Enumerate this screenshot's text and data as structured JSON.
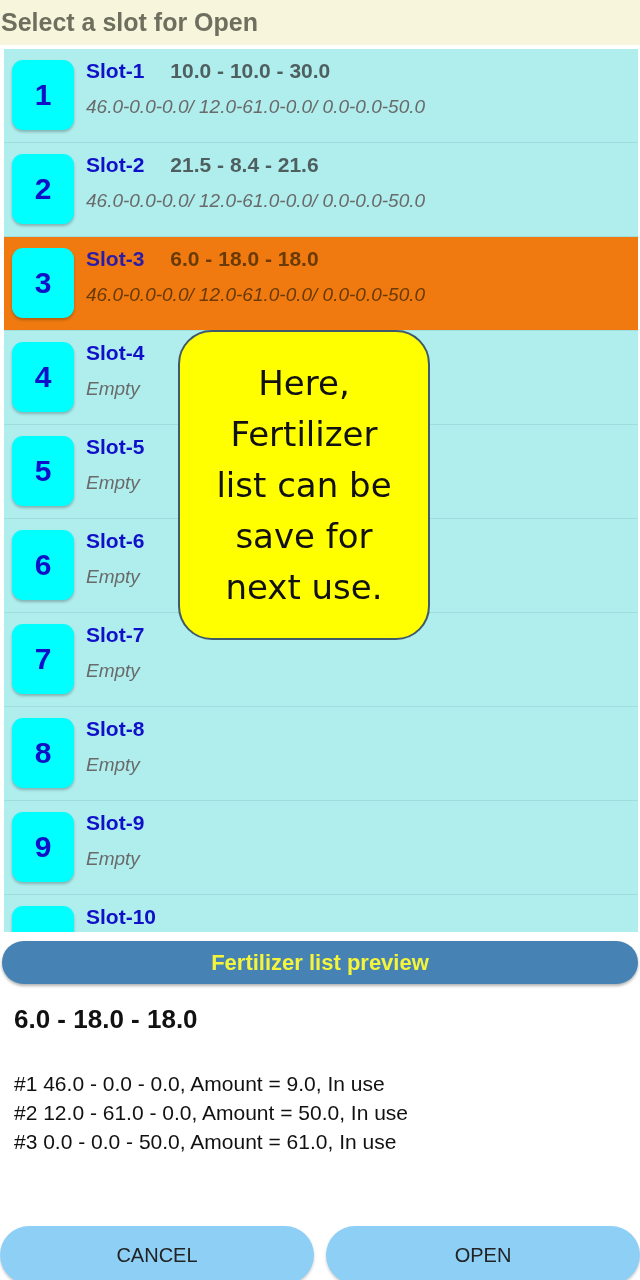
{
  "title": "Select a slot for Open",
  "slots": [
    {
      "number": "1",
      "name": "Slot-1",
      "npk": "10.0 - 10.0 - 30.0",
      "detail": "46.0-0.0-0.0/ 12.0-61.0-0.0/ 0.0-0.0-50.0",
      "selected": false
    },
    {
      "number": "2",
      "name": "Slot-2",
      "npk": "21.5 - 8.4 - 21.6",
      "detail": "46.0-0.0-0.0/ 12.0-61.0-0.0/ 0.0-0.0-50.0",
      "selected": false
    },
    {
      "number": "3",
      "name": "Slot-3",
      "npk": "6.0 - 18.0 - 18.0",
      "detail": "46.0-0.0-0.0/ 12.0-61.0-0.0/ 0.0-0.0-50.0",
      "selected": true
    },
    {
      "number": "4",
      "name": "Slot-4",
      "detail": "Empty",
      "selected": false
    },
    {
      "number": "5",
      "name": "Slot-5",
      "detail": "Empty",
      "selected": false
    },
    {
      "number": "6",
      "name": "Slot-6",
      "detail": "Empty",
      "selected": false
    },
    {
      "number": "7",
      "name": "Slot-7",
      "detail": "Empty",
      "selected": false
    },
    {
      "number": "8",
      "name": "Slot-8",
      "detail": "Empty",
      "selected": false
    },
    {
      "number": "9",
      "name": "Slot-9",
      "detail": "Empty",
      "selected": false
    },
    {
      "name": "Slot-10",
      "selected": false
    }
  ],
  "callout": "Here,\nFertilizer\nlist can be\nsave for\nnext use.",
  "preview": {
    "header": "Fertilizer list preview",
    "summary": "6.0 - 18.0 - 18.0",
    "lines": [
      "#1 46.0 - 0.0 - 0.0, Amount = 9.0, In use",
      "#2 12.0 - 61.0 - 0.0, Amount = 50.0, In use",
      "#3 0.0 - 0.0 - 50.0, Amount = 61.0, In use"
    ]
  },
  "buttons": [
    "CANCEL",
    "OPEN"
  ]
}
